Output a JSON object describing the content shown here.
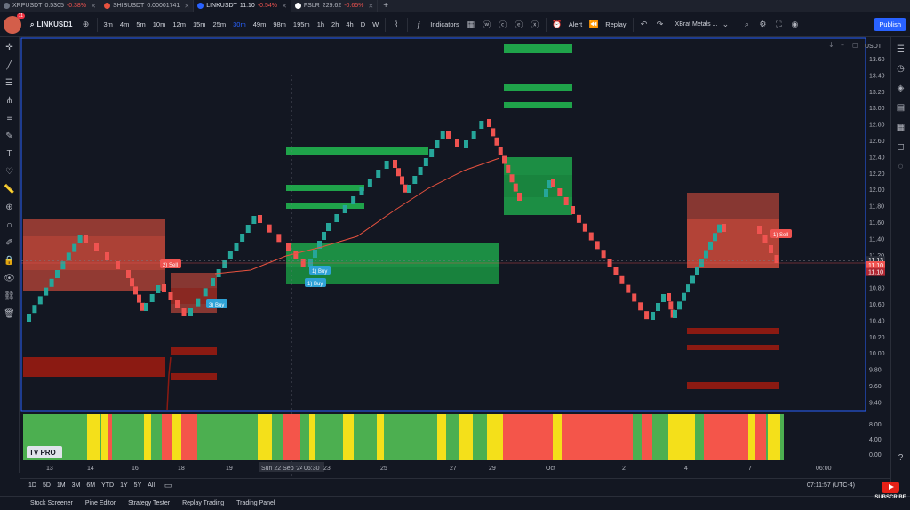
{
  "browser_tabs": [
    {
      "symbol": "XRPUSDT",
      "price": "0.5305",
      "change": "-0.38%",
      "dir": "down"
    },
    {
      "symbol": "SHIBUSDT",
      "price": "0.00001741",
      "change": "",
      "dir": "none"
    },
    {
      "symbol": "LINKUSDT",
      "price": "11.10",
      "change": "-0.54%",
      "dir": "down"
    },
    {
      "symbol": "FSLR",
      "price": "229.62",
      "change": "-0.65%",
      "dir": "down"
    }
  ],
  "toolbar": {
    "symbol": "LINKUSD1",
    "timeframes": [
      "3m",
      "4m",
      "5m",
      "10m",
      "12m",
      "15m",
      "25m",
      "30m",
      "49m",
      "98m",
      "195m",
      "1h",
      "2h",
      "4h",
      "D",
      "W"
    ],
    "active_timeframe": "30m",
    "indicators_label": "Indicators",
    "alert_label": "Alert",
    "replay_label": "Replay",
    "layout_name": "XBrat Metals ...",
    "publish_label": "Publish"
  },
  "chart": {
    "currency": "USDT",
    "price_ticks": [
      "13.60",
      "13.40",
      "13.20",
      "13.00",
      "12.80",
      "12.60",
      "12.40",
      "12.20",
      "12.00",
      "11.80",
      "11.60",
      "11.40",
      "11.20",
      "11.00",
      "10.80",
      "10.60",
      "10.40",
      "10.20",
      "10.00",
      "9.80",
      "9.60",
      "9.40"
    ],
    "last_price_a": "11.13",
    "last_price_b": "11.10",
    "last_price_c": "11.10",
    "date_ticks": [
      "13",
      "14",
      "16",
      "18",
      "19",
      "Sun 22 Sep '24",
      "06:30",
      "23",
      "25",
      "27",
      "29",
      "Oct",
      "2",
      "4",
      "7",
      "06:00"
    ],
    "osc_ticks": [
      "8.00",
      "4.00",
      "0.00"
    ],
    "signals": [
      {
        "label": "2) Sell",
        "type": "sell"
      },
      {
        "label": "3) Buy",
        "type": "buy"
      },
      {
        "label": "1) Buy",
        "type": "buy"
      },
      {
        "label": "1) Buy",
        "type": "buy"
      },
      {
        "label": "1) Sell",
        "type": "sell"
      }
    ],
    "colors": {
      "up": "#26a69a",
      "down": "#ef5350",
      "demand": "#1fa34a",
      "supply": "#e8523f",
      "dark_supply": "#8b1a12",
      "osc_green": "#4caf50",
      "osc_yellow": "#f4e01a",
      "osc_red": "#f4554a"
    }
  },
  "range_bar": {
    "ranges": [
      "1D",
      "5D",
      "1M",
      "3M",
      "6M",
      "YTD",
      "1Y",
      "5Y",
      "All"
    ],
    "clock": "07:11:57 (UTC-4)"
  },
  "bottom_tabs": [
    "Stock Screener",
    "Pine Editor",
    "Strategy Tester",
    "Replay Trading",
    "Trading Panel"
  ],
  "youtube": {
    "label": "SUBSCRIBE"
  }
}
